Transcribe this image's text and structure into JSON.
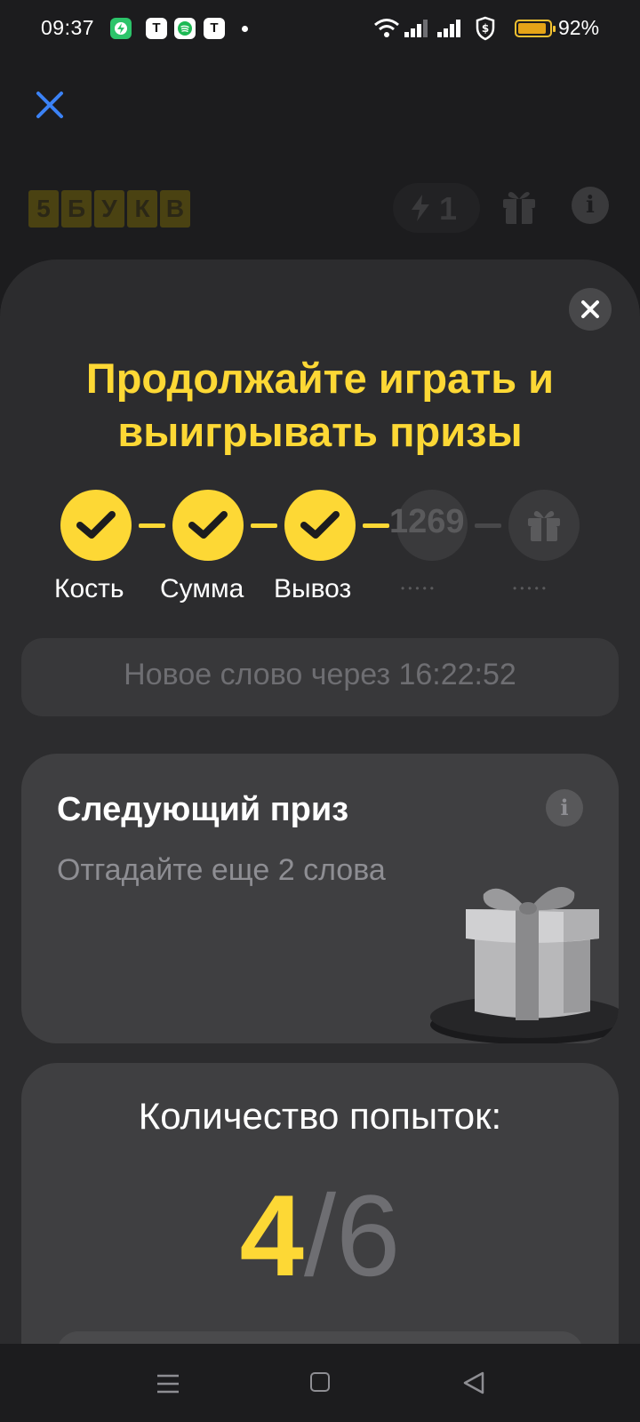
{
  "status_bar": {
    "time": "09:37",
    "battery_percent": "92%",
    "battery_level": 0.92,
    "notification_apps": [
      "green-bolt-app-icon",
      "t-app-icon",
      "spotify-app-icon",
      "t-app-icon"
    ],
    "app_letters": [
      "T",
      "T"
    ]
  },
  "header": {
    "logo_letters": [
      "5",
      "Б",
      "У",
      "К",
      "В"
    ],
    "energy_count": "1"
  },
  "sheet": {
    "title": "Продолжайте играть и выигрывать призы",
    "progress": {
      "steps": [
        {
          "label": "Кость",
          "state": "done"
        },
        {
          "label": "Сумма",
          "state": "done"
        },
        {
          "label": "Вывоз",
          "state": "done"
        },
        {
          "label": "•••••",
          "state": "pending",
          "overlay_text": "1269"
        },
        {
          "label": "•••••",
          "state": "locked-gift"
        }
      ]
    },
    "timer_text": "Новое слово через 16:22:52",
    "next_prize": {
      "title": "Следующий приз",
      "subtitle": "Отгадайте еще 2 слова"
    },
    "attempts": {
      "title": "Количество попыток:",
      "current": "4",
      "separator": "/",
      "max": "6"
    }
  },
  "colors": {
    "accent_yellow": "#fdd835",
    "sheet_bg": "#2c2c2e",
    "card_bg": "#3f3f41",
    "page_bg": "#1c1c1e",
    "close_blue": "#3b82f6"
  }
}
